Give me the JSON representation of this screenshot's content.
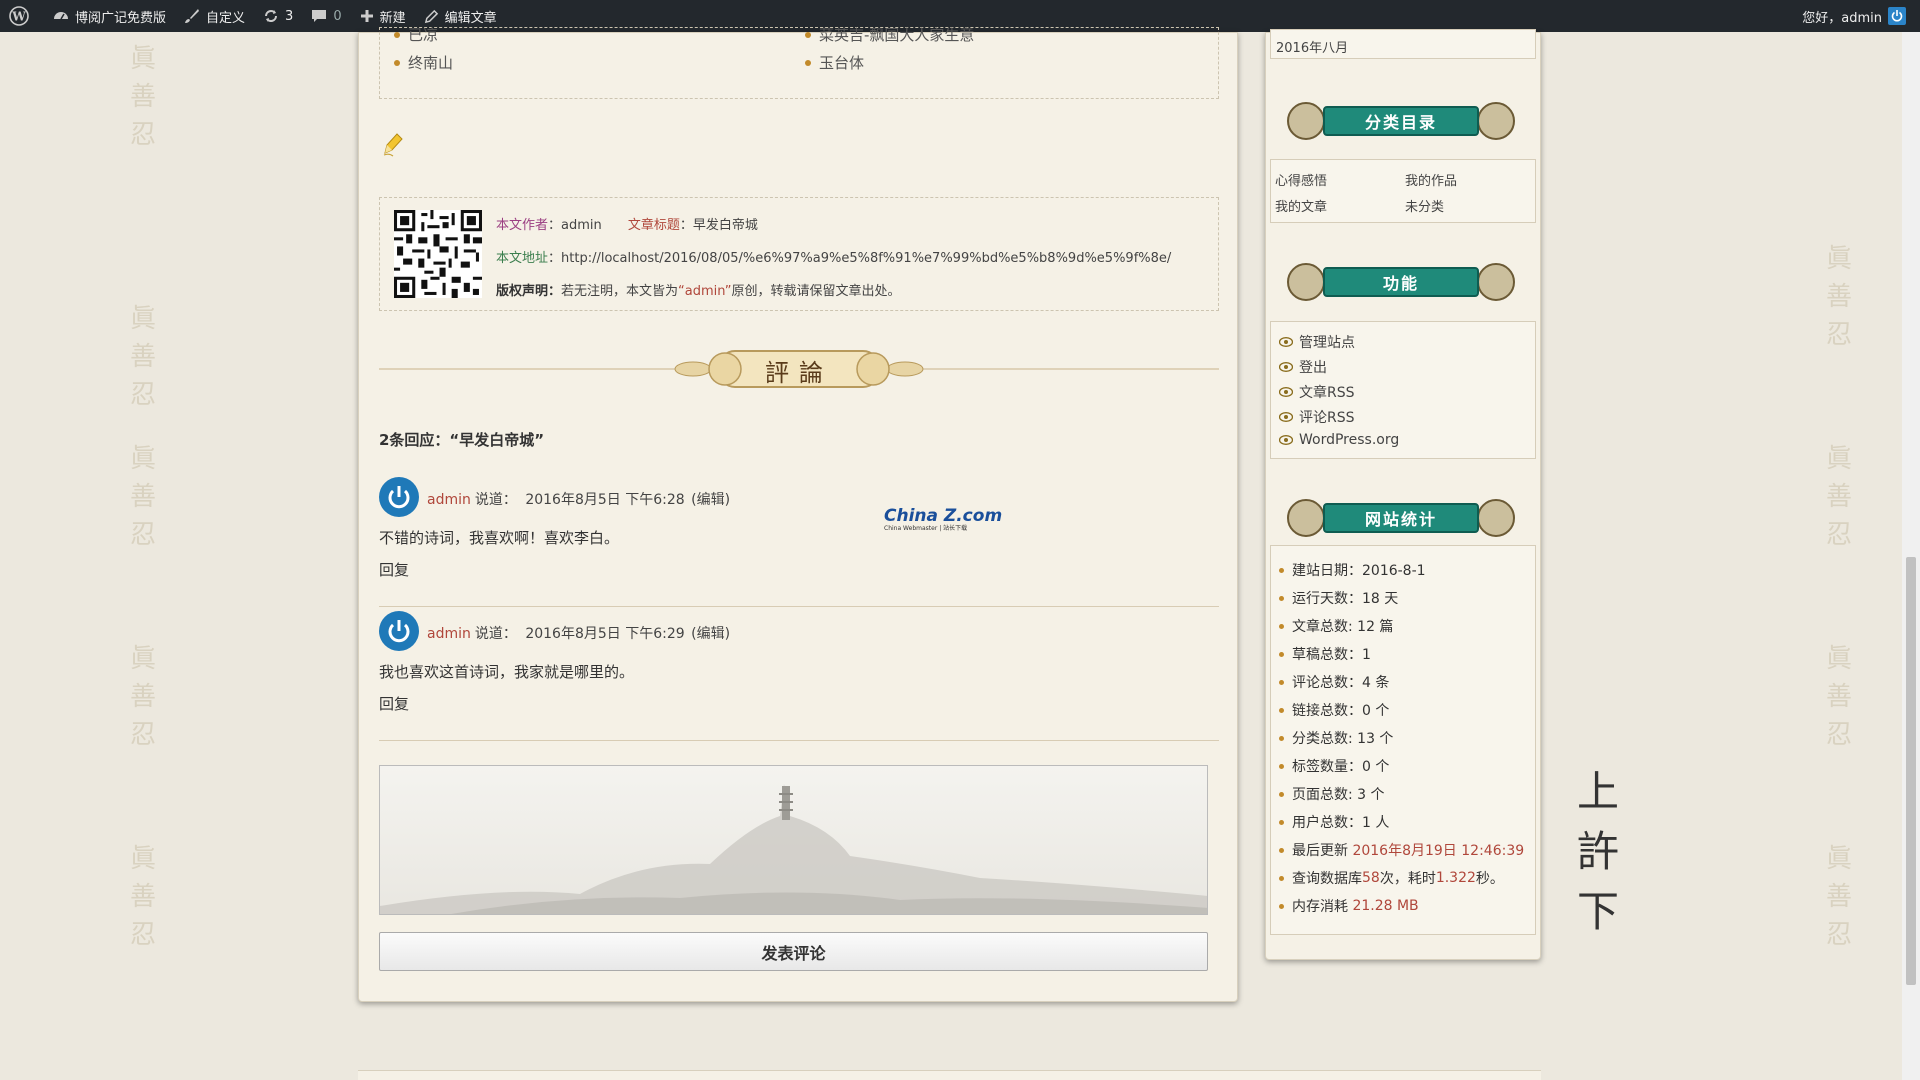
{
  "adminbar": {
    "site_name": "博阅广记免费版",
    "customize": "自定义",
    "updates_count": "3",
    "comments_count": "0",
    "new": "新建",
    "edit_post": "编辑文章",
    "greeting": "您好，admin"
  },
  "related": {
    "items": [
      "已凉",
      "菜英吉-飘国大人家生意",
      "终南山",
      "玉台体"
    ]
  },
  "post_info": {
    "author_label": "本文作者",
    "author_value": "：admin",
    "title_label": "文章标题",
    "title_value": "：早发白帝城",
    "url_label": "本文地址",
    "url_value": "：http://localhost/2016/08/05/%e6%97%a9%e5%8f%91%e7%99%bd%e5%b8%9d%e5%9f%8e/",
    "copyright_label": "版权声明：",
    "copyright_text_1": "若无注明，本文皆为",
    "copyright_author": "“admin”",
    "copyright_text_2": "原创，转载请保留文章出处。"
  },
  "comments": {
    "divider_text": "評論",
    "title": "2条回应：“早发白帝城”",
    "list": [
      {
        "author": "admin",
        "said": "说道：",
        "date": "2016年8月5日 下午6:28",
        "edit": "(编辑)",
        "body": "不错的诗词，我喜欢啊！喜欢李白。",
        "reply": "回复"
      },
      {
        "author": "admin",
        "said": "说道：",
        "date": "2016年8月5日 下午6:29",
        "edit": "(编辑)",
        "body": "我也喜欢这首诗词，我家就是哪里的。",
        "reply": "回复"
      }
    ],
    "watermark_logo": "China Z.com",
    "watermark_sub": "China Webmaster | 站长下载",
    "submit": "发表评论"
  },
  "sidebar": {
    "archive_month": "2016年八月",
    "categories_title": "分类目录",
    "categories": [
      "心得感悟",
      "我的作品",
      "我的文章",
      "未分类"
    ],
    "functions_title": "功能",
    "functions": [
      "管理站点",
      "登出",
      "文章RSS",
      "评论RSS",
      "WordPress.org"
    ],
    "stats_title": "网站统计",
    "stats": [
      {
        "label": "建站日期：2016-8-1"
      },
      {
        "label": "运行天数：18 天"
      },
      {
        "label": "文章总数: 12 篇"
      },
      {
        "label": "草稿总数：1"
      },
      {
        "label": "评论总数：4 条"
      },
      {
        "label": "链接总数：0 个"
      },
      {
        "label": "分类总数: 13 个"
      },
      {
        "label": "标签数量：0 个"
      },
      {
        "label": "页面总数: 3 个"
      },
      {
        "label": "用户总数：1 人"
      }
    ],
    "last_update_label": "最后更新",
    "last_update_value": "2016年8月19日 12:46:39",
    "query_label_1": "查询数据库",
    "query_count": "58",
    "query_label_2": "次，耗时",
    "query_time": "1.322",
    "query_label_3": "秒。",
    "memory_label": "内存消耗",
    "memory_value": "21.28 MB"
  },
  "side_calligraphy": [
    "上",
    "許",
    "下"
  ],
  "colors": {
    "adminbar": "#23282d",
    "accent_red": "#b0473b",
    "banner_teal": "#1f8a7a"
  }
}
